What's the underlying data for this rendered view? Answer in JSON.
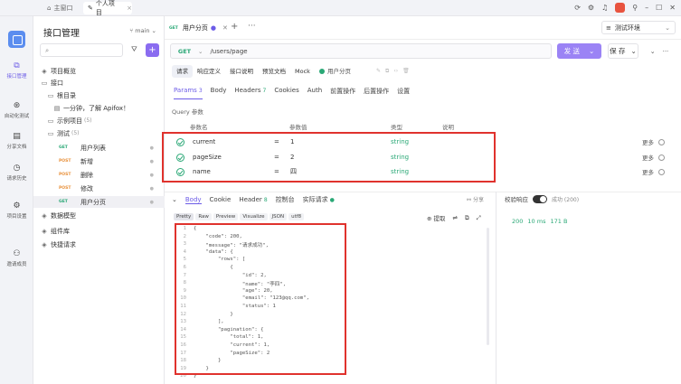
{
  "titlebar": {
    "home_label": "主窗口",
    "tab_label": "个人项目",
    "close": "×",
    "icons": [
      "sync-icon",
      "settings-icon",
      "bell-icon",
      "avatar",
      "pin-icon",
      "minimize-icon",
      "maximize-icon",
      "close-icon"
    ]
  },
  "rail": {
    "items": [
      {
        "label": "接口管理",
        "icon": "api-icon"
      },
      {
        "label": "自动化测试",
        "icon": "test-icon"
      },
      {
        "label": "分享文档",
        "icon": "doc-icon"
      },
      {
        "label": "请求历史",
        "icon": "history-icon"
      },
      {
        "label": "项目设置",
        "icon": "settings-icon"
      },
      {
        "label": "邀请成员",
        "icon": "invite-icon"
      }
    ]
  },
  "sidebar": {
    "title": "接口管理",
    "branch": "main",
    "search_placeholder": "",
    "tree": [
      {
        "label": "项目概览",
        "icon": "overview-icon",
        "indent": 0,
        "count": ""
      },
      {
        "label": "接口",
        "icon": "folder-icon",
        "indent": 0,
        "count": ""
      },
      {
        "label": "根目录",
        "icon": "folder-icon",
        "indent": 1,
        "count": ""
      },
      {
        "label": "一分钟，了解 Apifox！",
        "icon": "doc-icon",
        "indent": 2,
        "count": ""
      },
      {
        "label": "示例项目",
        "icon": "folder-icon",
        "indent": 1,
        "count": "(5)"
      },
      {
        "label": "测试",
        "icon": "folder-icon",
        "indent": 1,
        "count": "(5)"
      },
      {
        "label": "用户列表",
        "method": "GET",
        "indent": 3
      },
      {
        "label": "新增",
        "method": "POST",
        "indent": 3
      },
      {
        "label": "删除",
        "method": "POST",
        "indent": 3
      },
      {
        "label": "修改",
        "method": "POST",
        "indent": 3
      },
      {
        "label": "用户分页",
        "method": "GET",
        "indent": 3,
        "selected": true
      },
      {
        "label": "数据模型",
        "icon": "model-icon",
        "indent": 0,
        "count": ""
      },
      {
        "label": "组件库",
        "icon": "component-icon",
        "indent": 0,
        "count": ""
      },
      {
        "label": "快捷请求",
        "icon": "quick-icon",
        "indent": 0,
        "count": ""
      }
    ]
  },
  "request_tab": {
    "method": "GET",
    "name": "用户分页"
  },
  "env": {
    "label": "测试环境"
  },
  "url": {
    "method": "GET",
    "path": "/users/page"
  },
  "actions": {
    "send": "发 送",
    "save": "保 存"
  },
  "sub_tabs": [
    "请求",
    "响应定义",
    "接口说明",
    "预览文档",
    "Mock"
  ],
  "api_name": "用户分页",
  "param_tabs": [
    {
      "label": "Params",
      "count": "3",
      "active": true
    },
    {
      "label": "Body",
      "count": ""
    },
    {
      "label": "Headers",
      "count": "7"
    },
    {
      "label": "Cookies",
      "count": ""
    },
    {
      "label": "Auth",
      "count": ""
    },
    {
      "label": "前置操作",
      "count": ""
    },
    {
      "label": "后置操作",
      "count": ""
    },
    {
      "label": "设置",
      "count": ""
    }
  ],
  "query_label": "Query 参数",
  "columns": {
    "name": "参数名",
    "value": "参数值",
    "type": "类型",
    "desc": "说明"
  },
  "params": [
    {
      "name": "current",
      "value": "1",
      "type": "string",
      "more": "更多"
    },
    {
      "name": "pageSize",
      "value": "2",
      "type": "string",
      "more": "更多"
    },
    {
      "name": "name",
      "value": "四",
      "type": "string",
      "more": "更多"
    }
  ],
  "response_tabs": [
    {
      "label": "Body",
      "count": "",
      "active": true
    },
    {
      "label": "Cookie",
      "count": ""
    },
    {
      "label": "Header",
      "count": "8"
    },
    {
      "label": "控制台",
      "count": ""
    },
    {
      "label": "实际请求",
      "count": "●"
    }
  ],
  "share_label": "分享",
  "verify": {
    "label": "校验响应",
    "result": "成功 (200)"
  },
  "format_buttons": [
    "Pretty",
    "Raw",
    "Preview",
    "Visualize",
    "JSON",
    "utf8"
  ],
  "format_tools": [
    "提取",
    "copy",
    "expand"
  ],
  "response_status": {
    "code": "200",
    "time": "10 ms",
    "size": "171 B"
  },
  "code_lines": [
    "{",
    "    \"code\": 200,",
    "    \"message\": \"请求成功\",",
    "    \"data\": {",
    "        \"rows\": [",
    "            {",
    "                \"id\": 2,",
    "                \"name\": \"李四\",",
    "                \"age\": 20,",
    "                \"email\": \"123@qq.com\",",
    "                \"status\": 1",
    "            }",
    "        ],",
    "        \"pagination\": {",
    "            \"total\": 1,",
    "            \"current\": 1,",
    "            \"pageSize\": 2",
    "        }",
    "    }",
    "}"
  ]
}
